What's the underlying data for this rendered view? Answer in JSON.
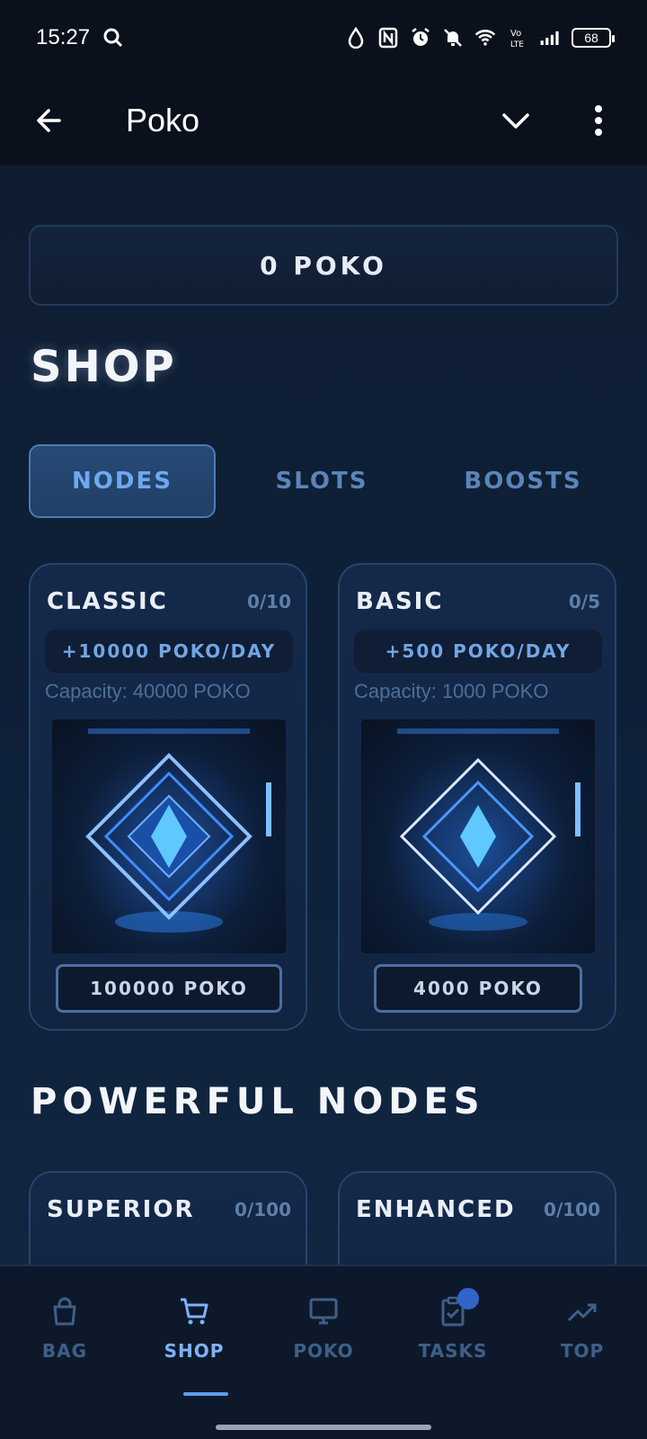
{
  "status": {
    "time": "15:27",
    "battery": "68",
    "icons": [
      "search-icon",
      "drop-icon",
      "nfc-icon",
      "alarm-icon",
      "mute-icon",
      "wifi-icon",
      "volte-icon",
      "signal-icon",
      "battery-icon"
    ]
  },
  "appbar": {
    "title": "Poko"
  },
  "balance": "0 POKO",
  "shop": {
    "heading": "SHOP",
    "tabs": [
      "NODES",
      "SLOTS",
      "BOOSTS"
    ]
  },
  "nodes": [
    {
      "name": "CLASSIC",
      "count": "0/10",
      "rate": "+10000 POKO/DAY",
      "capacity": "Capacity: 40000 POKO",
      "price": "100000 POKO"
    },
    {
      "name": "BASIC",
      "count": "0/5",
      "rate": "+500 POKO/DAY",
      "capacity": "Capacity: 1000 POKO",
      "price": "4000 POKO"
    }
  ],
  "powerful": {
    "heading": "POWERFUL NODES",
    "items": [
      {
        "name": "SUPERIOR",
        "count": "0/100"
      },
      {
        "name": "ENHANCED",
        "count": "0/100"
      }
    ]
  },
  "nav": {
    "items": [
      "BAG",
      "SHOP",
      "POKO",
      "TASKS",
      "TOP"
    ],
    "active": "SHOP"
  },
  "colors": {
    "accent": "#6fa8ee",
    "background": "#0b1424",
    "card": "#14294a"
  }
}
